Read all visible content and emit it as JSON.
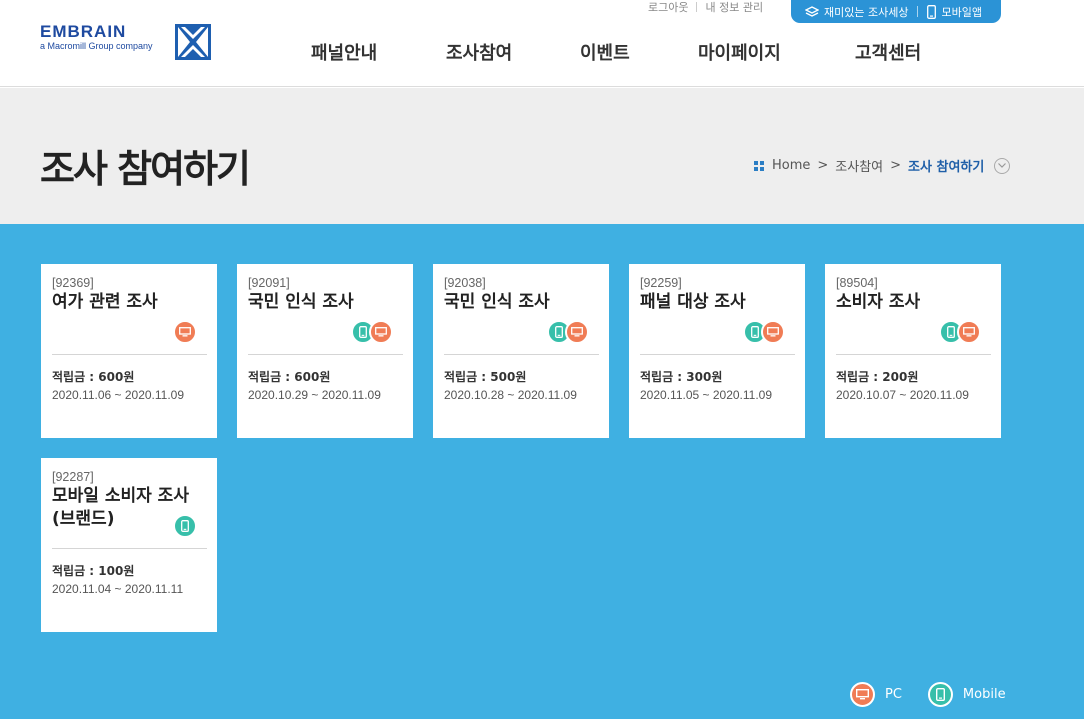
{
  "header": {
    "logo_text": "EMBRAIN",
    "logo_sub": "a Macromill Group company",
    "util_links": [
      "로그아웃",
      "내 정보 관리"
    ],
    "pill_links": [
      "재미있는 조사세상",
      "모바일앱"
    ],
    "nav": [
      "패널안내",
      "조사참여",
      "이벤트",
      "마이페이지",
      "고객센터"
    ]
  },
  "title_band": {
    "page_title": "조사 참여하기",
    "breadcrumb": [
      "Home",
      "조사참여",
      "조사 참여하기"
    ]
  },
  "surveys": [
    {
      "code": "[92369]",
      "title": "여가 관련 조사",
      "devices": [
        "pc"
      ],
      "points": "적립금 : 600원",
      "dates": "2020.11.06 ~ 2020.11.09"
    },
    {
      "code": "[92091]",
      "title": "국민 인식 조사",
      "devices": [
        "mobile",
        "pc"
      ],
      "points": "적립금 : 600원",
      "dates": "2020.10.29 ~ 2020.11.09"
    },
    {
      "code": "[92038]",
      "title": "국민 인식 조사",
      "devices": [
        "mobile",
        "pc"
      ],
      "points": "적립금 : 500원",
      "dates": "2020.10.28 ~ 2020.11.09"
    },
    {
      "code": "[92259]",
      "title": "패널 대상 조사",
      "devices": [
        "mobile",
        "pc"
      ],
      "points": "적립금 : 300원",
      "dates": "2020.11.05 ~ 2020.11.09"
    },
    {
      "code": "[89504]",
      "title": "소비자 조사",
      "devices": [
        "mobile",
        "pc"
      ],
      "points": "적립금 : 200원",
      "dates": "2020.10.07 ~ 2020.11.09"
    },
    {
      "code": "[92287]",
      "title": "모바일 소비자 조사(브랜드)",
      "devices": [
        "mobile"
      ],
      "points": "적립금 : 100원",
      "dates": "2020.11.04 ~ 2020.11.11"
    }
  ],
  "legend": {
    "pc": "PC",
    "mobile": "Mobile"
  },
  "colors": {
    "brand": "#1e4aa0",
    "accent": "#2b93d6",
    "background": "#3fb0e2",
    "pc": "#f07c55",
    "mobile": "#37bfaa"
  }
}
